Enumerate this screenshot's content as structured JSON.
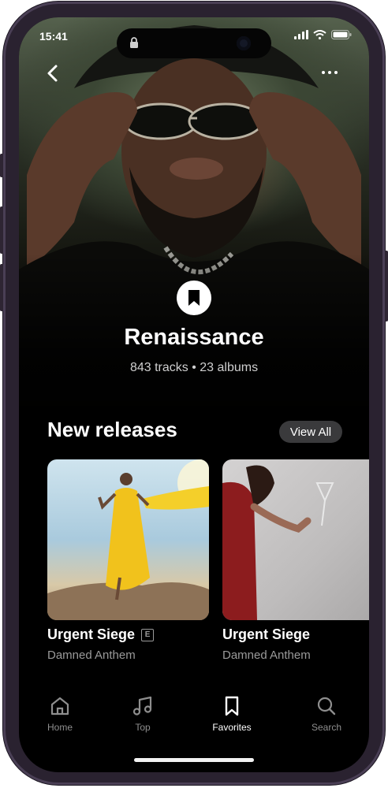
{
  "status_bar": {
    "time": "15:41"
  },
  "header": {
    "back_icon": "chevron-left-icon",
    "more_icon": "more-horizontal-icon"
  },
  "playlist": {
    "badge_icon": "bookmark-icon",
    "title": "Renaissance",
    "meta": "843 tracks • 23 albums"
  },
  "new_releases": {
    "title": "New releases",
    "view_all_label": "View All",
    "items": [
      {
        "title": "Urgent Siege",
        "artist": "Damned Anthem",
        "explicit": true,
        "explicit_label": "E"
      },
      {
        "title": "Urgent Siege",
        "artist": "Damned Anthem",
        "explicit": false
      }
    ]
  },
  "tabbar": {
    "items": [
      {
        "label": "Home",
        "icon": "home-icon",
        "active": false
      },
      {
        "label": "Top",
        "icon": "music-note-icon",
        "active": false
      },
      {
        "label": "Favorites",
        "icon": "bookmark-icon",
        "active": true
      },
      {
        "label": "Search",
        "icon": "search-icon",
        "active": false
      }
    ]
  },
  "colors": {
    "background": "#000000",
    "accent": "#ffffff",
    "muted_text": "#9a9a9a",
    "pill": "#3a3a3c"
  }
}
